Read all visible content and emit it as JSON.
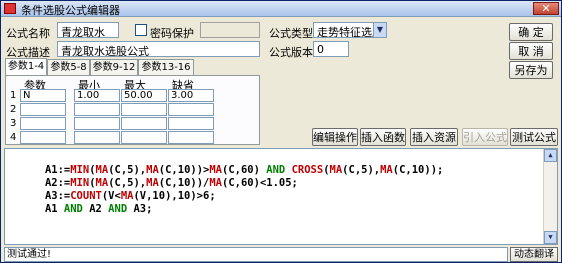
{
  "window": {
    "title": "条件选股公式编辑器",
    "close": "✕"
  },
  "form": {
    "name_label": "公式名称",
    "name_value": "青龙取水",
    "password_label": "密码保护",
    "type_label": "公式类型",
    "type_value": "走势特征选股",
    "desc_label": "公式描述",
    "desc_value": "青龙取水选股公式",
    "version_label": "公式版本",
    "version_value": "0"
  },
  "buttons": {
    "ok": "确  定",
    "cancel": "取  消",
    "save_as": "另存为",
    "edit_op": "编辑操作",
    "insert_func": "插入函数",
    "insert_res": "插入资源",
    "import_formula": "引入公式",
    "test_formula": "测试公式"
  },
  "tabs": [
    "参数1-4",
    "参数5-8",
    "参数9-12",
    "参数13-16"
  ],
  "params": {
    "headers": [
      "参数",
      "最小",
      "最大",
      "缺省"
    ],
    "rows": [
      {
        "num": "1",
        "name": "N",
        "min": "1.00",
        "max": "50.00",
        "def": "3.00"
      },
      {
        "num": "2",
        "name": "",
        "min": "",
        "max": "",
        "def": ""
      },
      {
        "num": "3",
        "name": "",
        "min": "",
        "max": "",
        "def": ""
      },
      {
        "num": "4",
        "name": "",
        "min": "",
        "max": "",
        "def": ""
      }
    ]
  },
  "code": {
    "l1": [
      "A1:=",
      "MIN",
      "(",
      "MA",
      "(C,5),",
      "MA",
      "(C,10))>",
      "MA",
      "(C,60) ",
      "AND",
      " ",
      "CROSS",
      "(",
      "MA",
      "(C,5),",
      "MA",
      "(C,10));"
    ],
    "l2": [
      "A2:=",
      "MIN",
      "(",
      "MA",
      "(C,5),",
      "MA",
      "(C,10))/",
      "MA",
      "(C,60)<1.05;"
    ],
    "l3": [
      "A3:=",
      "COUNT",
      "(V<",
      "MA",
      "(V,10),10)>6;"
    ],
    "l4": [
      "A1 ",
      "AND",
      " A2 ",
      "AND",
      " A3;"
    ]
  },
  "status": {
    "text": "测试通过!",
    "translate": "动态翻译"
  }
}
